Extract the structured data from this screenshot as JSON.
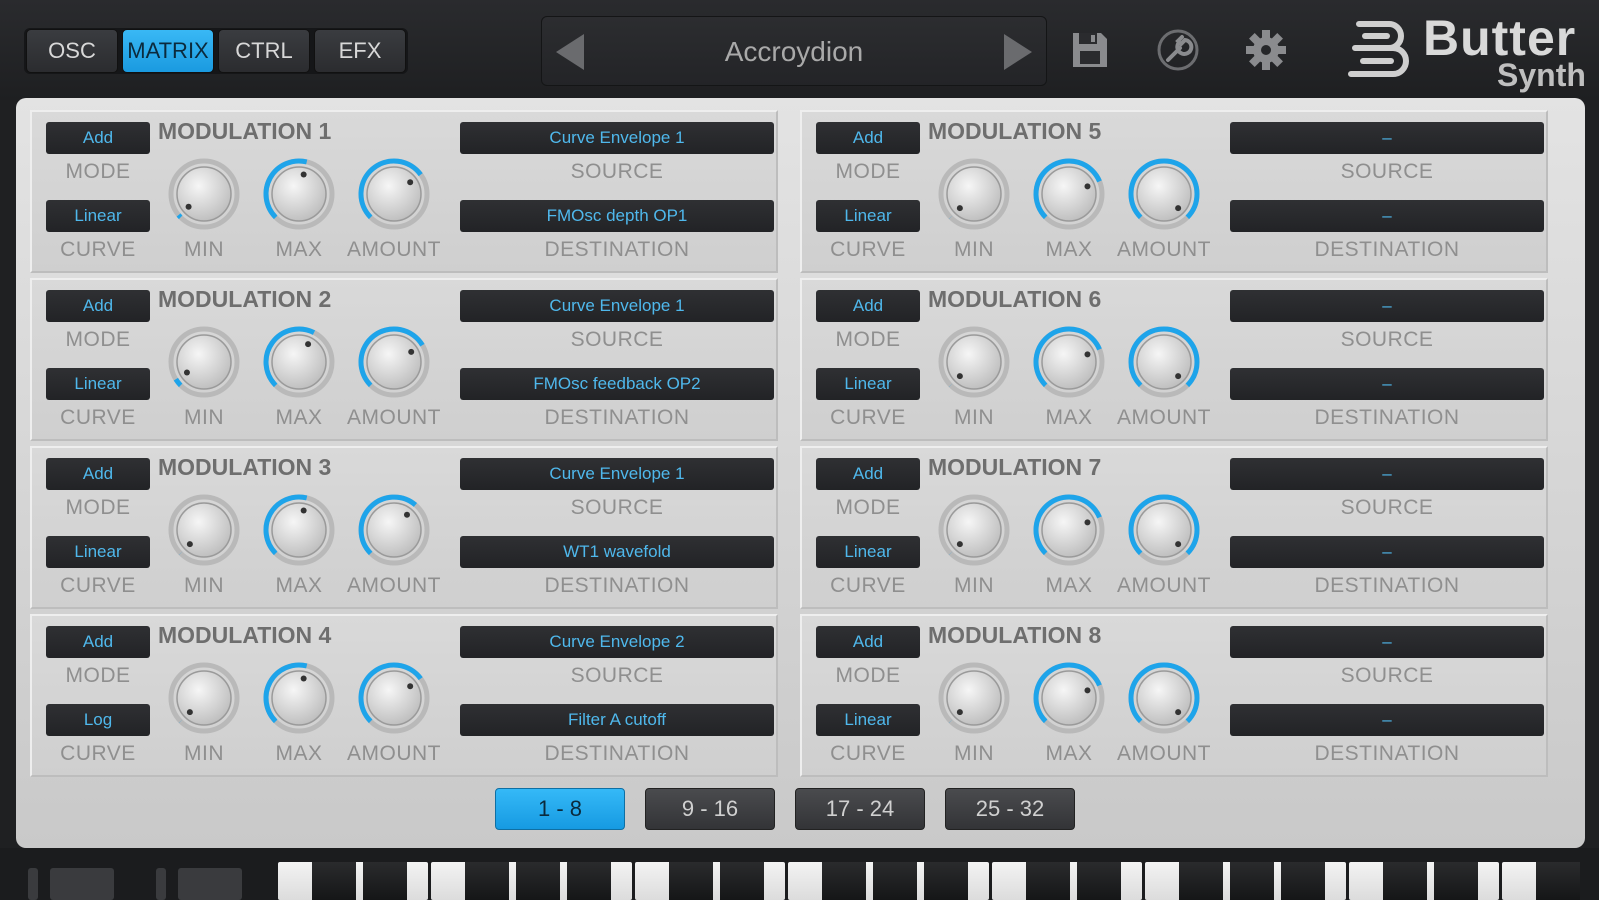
{
  "tabs": [
    "OSC",
    "MATRIX",
    "CTRL",
    "EFX"
  ],
  "active_tab": "MATRIX",
  "preset": {
    "name": "Accroydion"
  },
  "toolbar_icons": [
    "save-icon",
    "wrench-icon",
    "gear-icon"
  ],
  "logo": {
    "word1": "Butter",
    "word2": "Synth"
  },
  "labels": {
    "mode": "MODE",
    "curve": "CURVE",
    "min": "MIN",
    "max": "MAX",
    "amount": "AMOUNT",
    "source": "SOURCE",
    "destination": "DESTINATION"
  },
  "modulations": [
    {
      "title": "MODULATION 1",
      "mode": "Add",
      "curve": "Linear",
      "source": "Curve Envelope 1",
      "destination": "FMOsc depth OP1",
      "min": 0.02,
      "max": 0.55,
      "amount": 0.7
    },
    {
      "title": "MODULATION 2",
      "mode": "Add",
      "curve": "Linear",
      "source": "Curve Envelope 1",
      "destination": "FMOsc feedback OP2",
      "min": 0.05,
      "max": 0.6,
      "amount": 0.72
    },
    {
      "title": "MODULATION 3",
      "mode": "Add",
      "curve": "Linear",
      "source": "Curve Envelope 1",
      "destination": "WT1 wavefold",
      "min": 0.0,
      "max": 0.55,
      "amount": 0.65
    },
    {
      "title": "MODULATION 4",
      "mode": "Add",
      "curve": "Log",
      "source": "Curve Envelope 2",
      "destination": "Filter A cutoff",
      "min": 0.0,
      "max": 0.55,
      "amount": 0.7
    },
    {
      "title": "MODULATION 5",
      "mode": "Add",
      "curve": "Linear",
      "source": "–",
      "destination": "–",
      "min": 0.0,
      "max": 0.75,
      "amount": 1.0
    },
    {
      "title": "MODULATION 6",
      "mode": "Add",
      "curve": "Linear",
      "source": "–",
      "destination": "–",
      "min": 0.0,
      "max": 0.75,
      "amount": 1.0
    },
    {
      "title": "MODULATION 7",
      "mode": "Add",
      "curve": "Linear",
      "source": "–",
      "destination": "–",
      "min": 0.0,
      "max": 0.75,
      "amount": 1.0
    },
    {
      "title": "MODULATION 8",
      "mode": "Add",
      "curve": "Linear",
      "source": "–",
      "destination": "–",
      "min": 0.0,
      "max": 0.75,
      "amount": 1.0
    }
  ],
  "pages": [
    "1 - 8",
    "9 - 16",
    "17 - 24",
    "25 - 32"
  ],
  "active_page": "1 - 8",
  "colors": {
    "accent": "#1ea4ea",
    "panel": "#d6d6d6",
    "label": "#8f8f8f",
    "dark": "#1f2022"
  }
}
